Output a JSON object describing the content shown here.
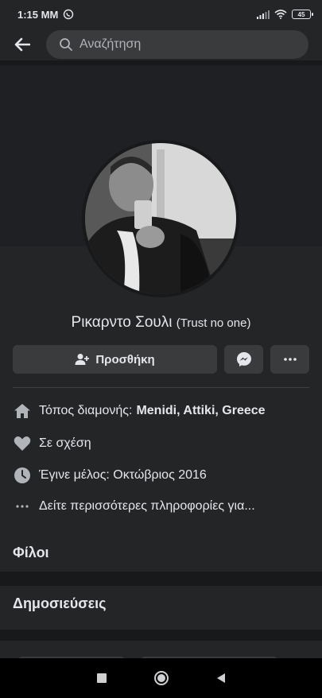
{
  "status_bar": {
    "time": "1:15 MM",
    "battery": "45",
    "icons": [
      "viber-icon",
      "signal-icon",
      "wifi-icon",
      "battery-icon"
    ]
  },
  "search": {
    "placeholder": "Αναζήτηση"
  },
  "profile": {
    "name": "Ρικαρντο Σουλι",
    "nickname": "(Trust no one)"
  },
  "actions": {
    "add_label": "Προσθήκη"
  },
  "info": {
    "lives_prefix": "Τόπος διαμονής:",
    "lives_value": "Menidi, Attiki, Greece",
    "relationship": "Σε σχέση",
    "joined": "Έγινε μέλος: Οκτώβριος 2016",
    "more": "Δείτε περισσότερες πληροφορίες για..."
  },
  "sections": {
    "friends": "Φίλοι",
    "posts": "Δημοσιεύσεις"
  },
  "colors": {
    "background": "#18191a",
    "surface": "#242526",
    "button": "#3a3b3c",
    "text": "#e4e6eb",
    "muted": "#b0b3b8"
  }
}
